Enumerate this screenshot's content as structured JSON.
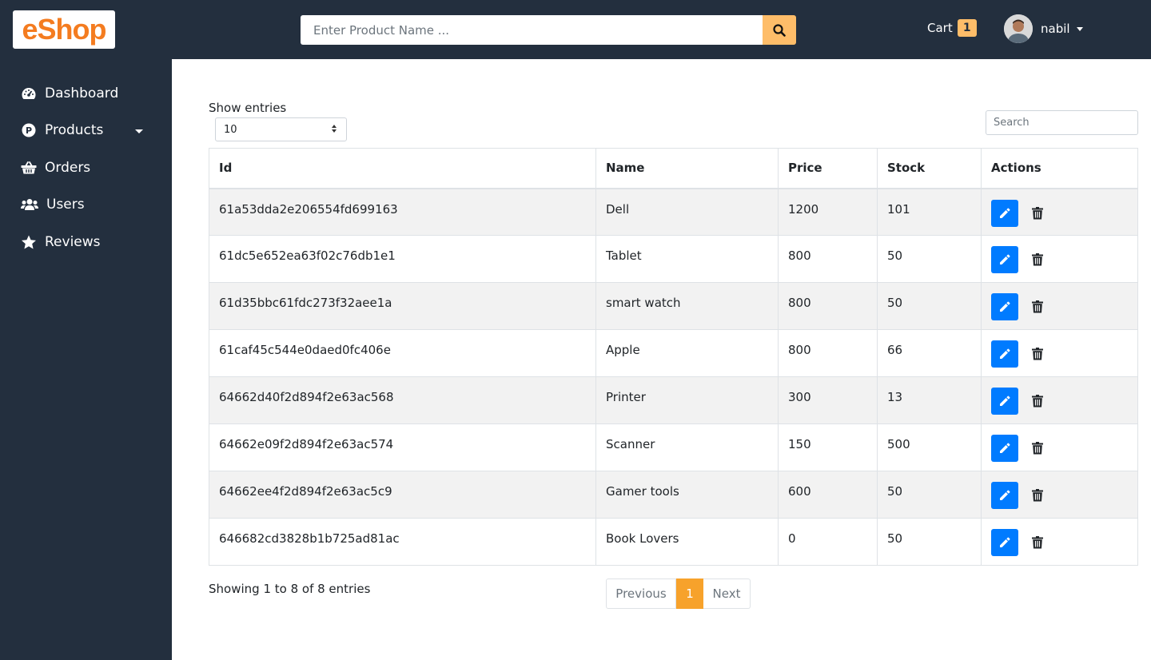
{
  "header": {
    "logo_text": "eShop",
    "search_placeholder": "Enter Product Name ...",
    "cart_label": "Cart",
    "cart_count": "1",
    "username": "nabil"
  },
  "sidebar": {
    "items": [
      {
        "label": "Dashboard",
        "icon": "tachometer-icon"
      },
      {
        "label": "Products",
        "icon": "product-p-icon"
      },
      {
        "label": "Orders",
        "icon": "basket-icon"
      },
      {
        "label": "Users",
        "icon": "users-icon"
      },
      {
        "label": "Reviews",
        "icon": "star-icon"
      }
    ]
  },
  "main": {
    "show_entries_label": "Show entries",
    "entries_value": "10",
    "search_placeholder": "Search",
    "columns": [
      "Id",
      "Name",
      "Price",
      "Stock",
      "Actions"
    ],
    "rows": [
      {
        "id": "61a53dda2e206554fd699163",
        "name": "Dell",
        "price": "1200",
        "stock": "101"
      },
      {
        "id": "61dc5e652ea63f02c76db1e1",
        "name": "Tablet",
        "price": "800",
        "stock": "50"
      },
      {
        "id": "61d35bbc61fdc273f32aee1a",
        "name": "smart watch",
        "price": "800",
        "stock": "50"
      },
      {
        "id": "61caf45c544e0daed0fc406e",
        "name": "Apple",
        "price": "800",
        "stock": "66"
      },
      {
        "id": "64662d40f2d894f2e63ac568",
        "name": "Printer",
        "price": "300",
        "stock": "13"
      },
      {
        "id": "64662e09f2d894f2e63ac574",
        "name": "Scanner",
        "price": "150",
        "stock": "500"
      },
      {
        "id": "64662ee4f2d894f2e63ac5c9",
        "name": "Gamer tools",
        "price": "600",
        "stock": "50"
      },
      {
        "id": "646682cd3828b1b725ad81ac",
        "name": "Book Lovers",
        "price": "0",
        "stock": "50"
      }
    ],
    "showing_text": "Showing 1 to 8 of 8 entries",
    "pagination": {
      "previous": "Previous",
      "current": "1",
      "next": "Next"
    }
  },
  "colors": {
    "navy": "#232f3e",
    "accent": "#febd69",
    "primary": "#007bff",
    "logo": "#f47c20"
  }
}
